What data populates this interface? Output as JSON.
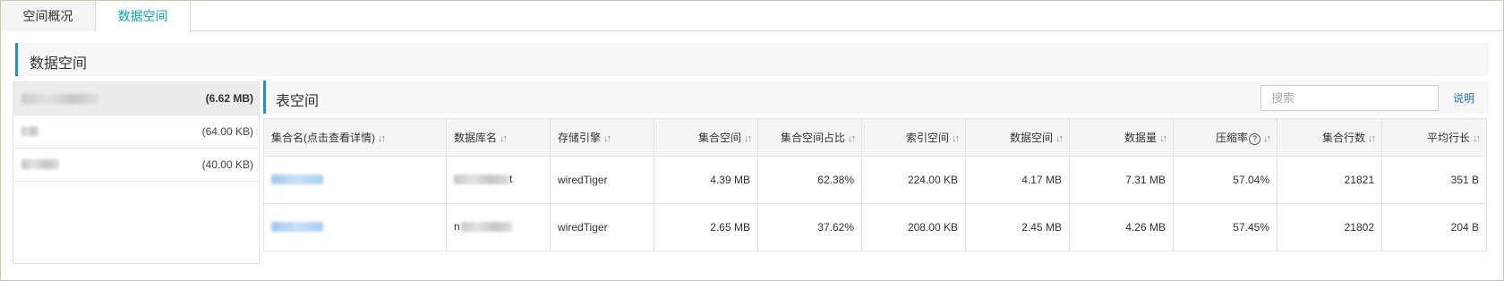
{
  "tabs": [
    {
      "label": "空间概况",
      "active": false
    },
    {
      "label": "数据空间",
      "active": true
    }
  ],
  "section": {
    "title": "数据空间"
  },
  "databases": [
    {
      "size": "(6.62 MB)",
      "active": true
    },
    {
      "size": "(64.00 KB)",
      "active": false
    },
    {
      "size": "(40.00 KB)",
      "active": false
    }
  ],
  "table_panel": {
    "title": "表空间",
    "search_placeholder": "搜索",
    "help_link": "说明"
  },
  "columns": [
    {
      "label": "集合名(点击查看详情)",
      "sort_icon": "sort-icon"
    },
    {
      "label": "数据库名",
      "sort_icon": "sort-icon"
    },
    {
      "label": "存储引擎",
      "sort_icon": "sort-icon"
    },
    {
      "label": "集合空间",
      "sort_icon": "sort-icon"
    },
    {
      "label": "集合空间占比",
      "sort_icon": "sort-icon"
    },
    {
      "label": "索引空间",
      "sort_icon": "sort-icon"
    },
    {
      "label": "数据空间",
      "sort_icon": "sort-icon"
    },
    {
      "label": "数据量",
      "sort_icon": "sort-icon"
    },
    {
      "label": "压缩率",
      "sort_icon": "sort-icon",
      "help_icon": "question-circle-icon"
    },
    {
      "label": "集合行数",
      "sort_icon": "sort-icon"
    },
    {
      "label": "平均行长",
      "sort_icon": "sort-icon"
    }
  ],
  "rows": [
    {
      "db_suffix": "t",
      "engine": "wiredTiger",
      "collection_space": "4.39 MB",
      "collection_space_pct": "62.38%",
      "index_space": "224.00 KB",
      "data_space": "4.17 MB",
      "data_size": "7.31 MB",
      "compression": "57.04%",
      "row_count": "21821",
      "avg_row_len": "351 B"
    },
    {
      "db_prefix": "n",
      "engine": "wiredTiger",
      "collection_space": "2.65 MB",
      "collection_space_pct": "37.62%",
      "index_space": "208.00 KB",
      "data_space": "2.45 MB",
      "data_size": "4.26 MB",
      "compression": "57.45%",
      "row_count": "21802",
      "avg_row_len": "204 B"
    }
  ],
  "icons": {
    "sort": "↓↑",
    "help": "?"
  },
  "colors": {
    "accent": "#1f8fd6",
    "active_tab": "#0aa6c8",
    "link": "#1f76c8"
  }
}
